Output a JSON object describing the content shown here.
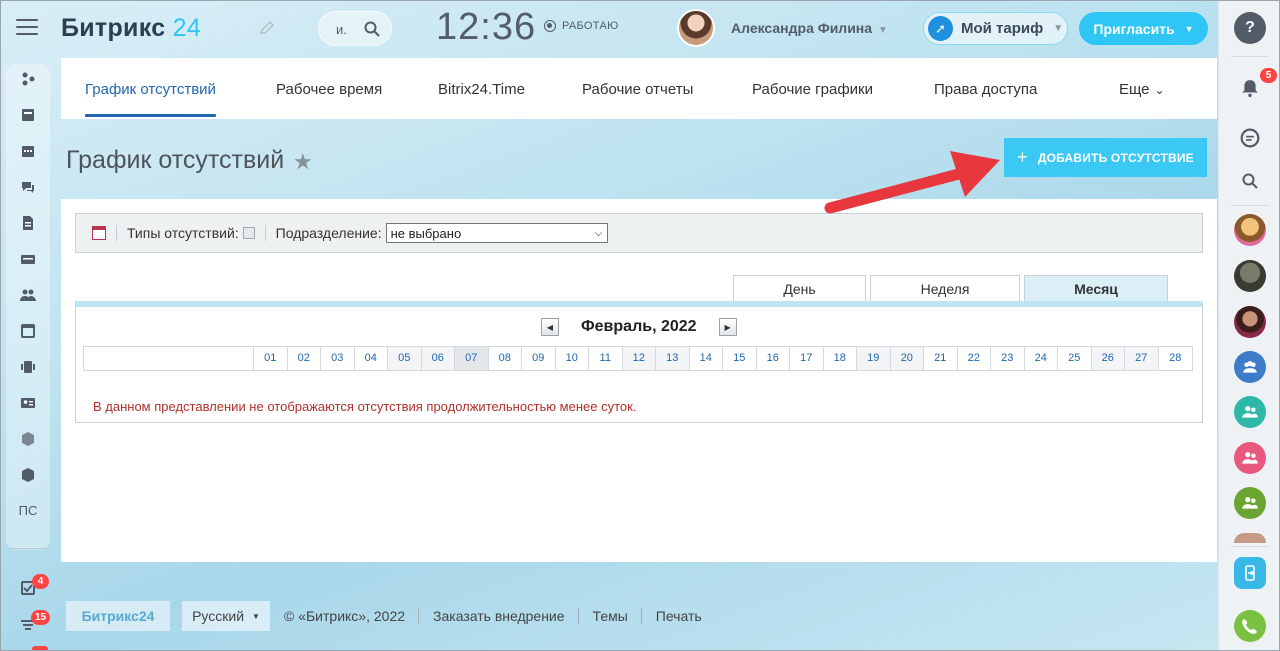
{
  "header": {
    "logo_text": "Битрикс",
    "logo_num": "24",
    "search_text": "и.",
    "clock": "12:36",
    "work_status": "РАБОТАЮ",
    "user_name": "Александра Филина",
    "tariff_label": "Мой тариф",
    "invite_label": "Пригласить"
  },
  "leftbar": {
    "ps_label": "ПС",
    "badge_tasks": "4",
    "badge_feed": "15"
  },
  "rightbar": {
    "notif_badge": "5"
  },
  "tabs": [
    {
      "label": "График отсутствий"
    },
    {
      "label": "Рабочее время"
    },
    {
      "label": "Bitrix24.Time"
    },
    {
      "label": "Рабочие отчеты"
    },
    {
      "label": "Рабочие графики"
    },
    {
      "label": "Права доступа"
    },
    {
      "label": "Еще"
    }
  ],
  "page": {
    "title": "График отсутствий",
    "add_button": "ДОБАВИТЬ ОТСУТСТВИЕ"
  },
  "filter": {
    "types_label": "Типы отсутствий:",
    "dept_label": "Подразделение:",
    "dept_value": "не выбрано"
  },
  "view_tabs": {
    "day": "День",
    "week": "Неделя",
    "month": "Месяц"
  },
  "calendar": {
    "month_label": "Февраль, 2022",
    "days": [
      "01",
      "02",
      "03",
      "04",
      "05",
      "06",
      "07",
      "08",
      "09",
      "10",
      "11",
      "12",
      "13",
      "14",
      "15",
      "16",
      "17",
      "18",
      "19",
      "20",
      "21",
      "22",
      "23",
      "24",
      "25",
      "26",
      "27",
      "28"
    ],
    "note": "В данном представлении не отображаются отсутствия продолжительностью менее суток."
  },
  "footer": {
    "logo": "Битрикс24",
    "language": "Русский",
    "copyright": "© «Битрикс», 2022",
    "order": "Заказать внедрение",
    "themes": "Темы",
    "print": "Печать"
  }
}
